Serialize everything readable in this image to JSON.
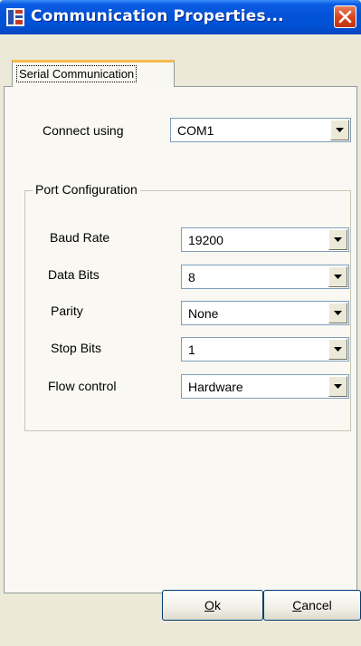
{
  "window": {
    "title": "Communication Properties...",
    "app_icon": "communication-app-icon",
    "close_icon": "close-icon",
    "colors": {
      "titlebar": "#0052d6",
      "close": "#d7431c",
      "face": "#ece9d8",
      "tab_highlight": "#f6b94b"
    }
  },
  "tabs": [
    {
      "label": "Serial Communication",
      "selected": true
    }
  ],
  "connect": {
    "label": "Connect using",
    "value": "COM1"
  },
  "port_config": {
    "title": "Port Configuration",
    "fields": [
      {
        "label": "Baud Rate",
        "value": "19200"
      },
      {
        "label": "Data Bits",
        "value": "8"
      },
      {
        "label": "Parity",
        "value": "None"
      },
      {
        "label": "Stop Bits",
        "value": "1"
      },
      {
        "label": "Flow control",
        "value": "Hardware"
      }
    ]
  },
  "buttons": {
    "ok": {
      "mnemonic": "O",
      "rest": "k"
    },
    "cancel": {
      "mnemonic": "C",
      "rest": "ancel"
    }
  }
}
